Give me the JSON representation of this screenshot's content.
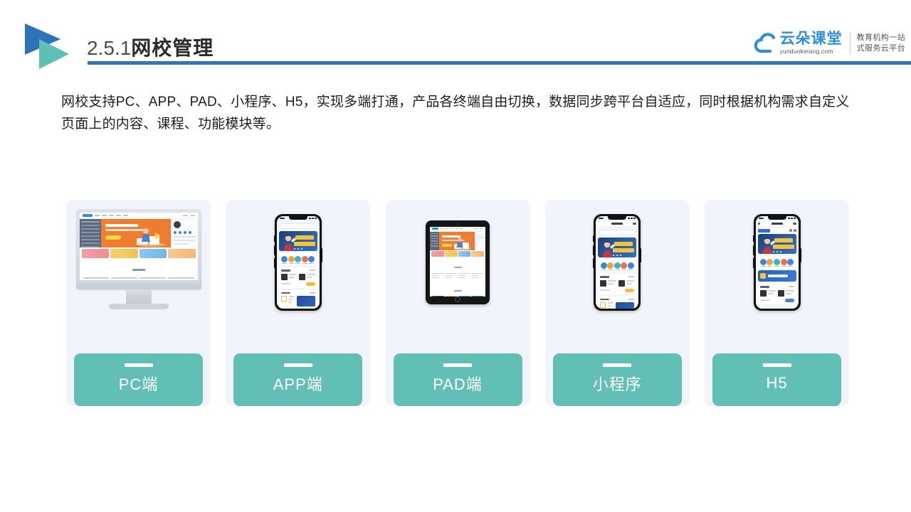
{
  "header": {
    "section_number": "2.5.1",
    "section_title": "网校管理",
    "rule_color": "#2f74b5",
    "logo_icon": "double-triangle-play-logo",
    "logo_colors": [
      "#2e72b8",
      "#5cc0b2"
    ]
  },
  "brand": {
    "icon": "cloud-icon",
    "name_cn": "云朵课堂",
    "name_en": "yunduoketang.com",
    "tagline_line1": "教育机构一站",
    "tagline_line2": "式服务云平台",
    "accent_color": "#2b8fe0"
  },
  "body": {
    "paragraph": "网校支持PC、APP、PAD、小程序、H5，实现多端打通，产品各终端自由切换，数据同步跨平台自适应，同时根据机构需求自定义页面上的内容、课程、功能模块等。"
  },
  "cards": {
    "accent_color": "#62bfb5",
    "background_color": "#f1f4fa",
    "items": [
      {
        "label": "PC端",
        "device": "desktop-monitor",
        "device_icon": "desktop-monitor-icon"
      },
      {
        "label": "APP端",
        "device": "smartphone",
        "device_icon": "smartphone-icon"
      },
      {
        "label": "PAD端",
        "device": "tablet",
        "device_icon": "tablet-icon"
      },
      {
        "label": "小程序",
        "device": "smartphone",
        "device_icon": "smartphone-icon"
      },
      {
        "label": "H5",
        "device": "smartphone",
        "device_icon": "smartphone-icon"
      }
    ]
  }
}
